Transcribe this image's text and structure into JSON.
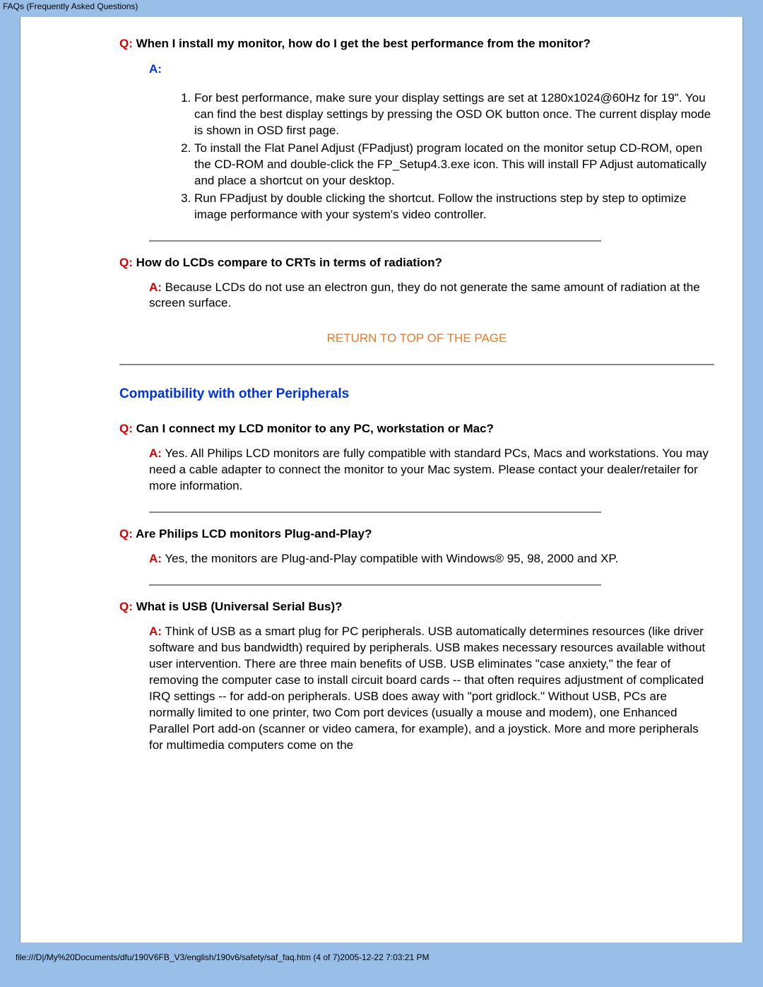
{
  "header": {
    "title": "FAQs (Frequently Asked Questions)"
  },
  "faqs": [
    {
      "q_label": "Q:",
      "q_text": " When I install my monitor, how do I get the best performance from the monitor?",
      "a_label": "A:",
      "steps": [
        "For best performance, make sure your display settings are set at 1280x1024@60Hz for 19\". You can find the best display settings by pressing the OSD OK button once. The current display mode is shown in OSD first page.",
        "To install the Flat Panel Adjust (FPadjust) program located on the monitor setup CD-ROM, open the CD-ROM and double-click the FP_Setup4.3.exe icon. This will install FP Adjust automatically and place a shortcut on your desktop.",
        "Run FPadjust by double clicking the shortcut. Follow the instructions step by step to optimize image performance with your system's video controller."
      ]
    },
    {
      "q_label": "Q:",
      "q_text": " How do LCDs compare to CRTs in terms of radiation?",
      "a_label": "A:",
      "a_text": " Because LCDs do not use an electron gun, they do not generate the same amount of radiation at the screen surface."
    }
  ],
  "return_link": "RETURN TO TOP OF THE PAGE",
  "section_heading": "Compatibility with other Peripherals",
  "compat": [
    {
      "q_label": "Q:",
      "q_text": " Can I connect my LCD monitor to any PC, workstation or Mac?",
      "a_label": "A:",
      "a_text": " Yes. All Philips LCD monitors are fully compatible with standard PCs, Macs and workstations. You may need a cable adapter to connect the monitor to your Mac system. Please contact your dealer/retailer for more information."
    },
    {
      "q_label": "Q:",
      "q_text": " Are Philips LCD monitors Plug-and-Play?",
      "a_label": "A:",
      "a_text": " Yes, the monitors are Plug-and-Play compatible with Windows® 95, 98, 2000 and XP."
    },
    {
      "q_label": "Q:",
      "q_text": " What is USB (Universal Serial Bus)?",
      "a_label": "A:",
      "a_text": " Think of USB as a smart plug for PC peripherals. USB automatically determines resources (like driver software and bus bandwidth) required by peripherals. USB makes necessary resources available without user intervention. There are three main benefits of USB. USB eliminates \"case anxiety,\" the fear of removing the computer case to install circuit board cards -- that often requires adjustment of complicated IRQ settings -- for add-on peripherals. USB does away with \"port gridlock.\" Without USB, PCs are normally limited to one printer, two Com port devices (usually a mouse and modem), one Enhanced Parallel Port add-on (scanner or video camera, for example), and a joystick. More and more peripherals for multimedia computers come on the"
    }
  ],
  "footer": {
    "path": "file:///D|/My%20Documents/dfu/190V6FB_V3/english/190v6/safety/saf_faq.htm (4 of 7)2005-12-22 7:03:21 PM"
  }
}
